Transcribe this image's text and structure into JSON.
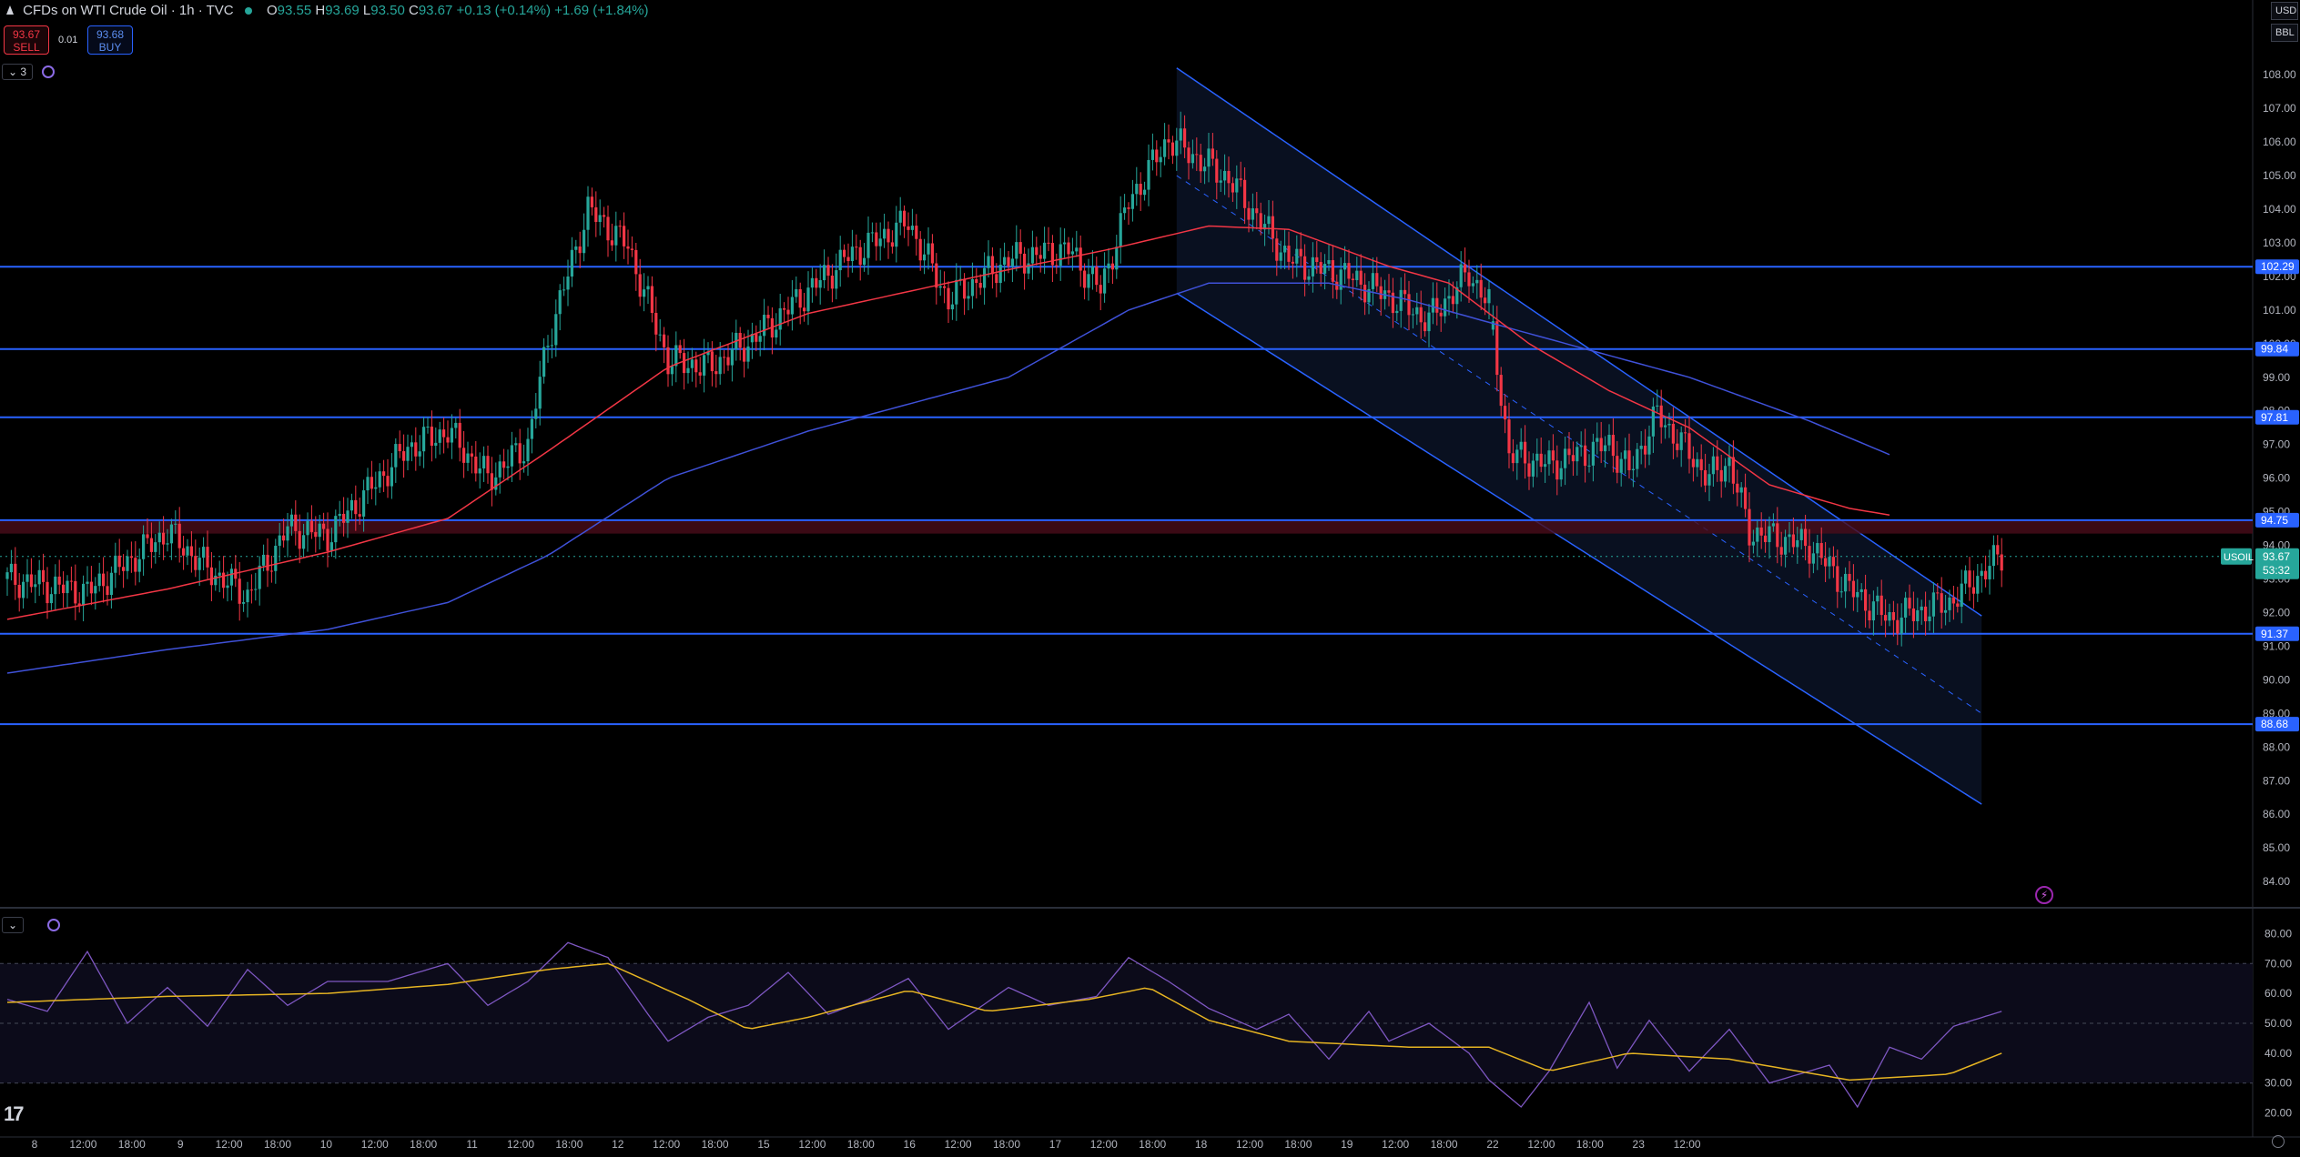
{
  "symbol": {
    "title": "CFDs on WTI Crude Oil · 1h · TVC",
    "open_label": "O",
    "open": "93.55",
    "high_label": "H",
    "high": "93.69",
    "low_label": "L",
    "low": "93.50",
    "close_label": "C",
    "close": "93.67",
    "change": "+0.13 (+0.14%)",
    "change_day": "+1.69 (+1.84%)"
  },
  "trade": {
    "sell_price": "93.67",
    "sell_label": "SELL",
    "buy_price": "93.68",
    "buy_label": "BUY",
    "spread": "0.01"
  },
  "indicators_toggle": "3",
  "currency": "USD",
  "unit": "BBL",
  "price_axis": {
    "ticks": [
      "108.00",
      "107.00",
      "106.00",
      "105.00",
      "104.00",
      "103.00",
      "102.00",
      "101.00",
      "100.00",
      "99.00",
      "98.00",
      "97.00",
      "96.00",
      "95.00",
      "94.00",
      "93.00",
      "92.00",
      "91.00",
      "90.00",
      "89.00",
      "88.00",
      "87.00",
      "86.00",
      "85.00",
      "84.00"
    ],
    "levels": [
      {
        "value": 102.29,
        "label": "102.29"
      },
      {
        "value": 99.84,
        "label": "99.84"
      },
      {
        "value": 97.81,
        "label": "97.81"
      },
      {
        "value": 94.75,
        "label": "94.75"
      },
      {
        "value": 91.37,
        "label": "91.37"
      },
      {
        "value": 88.68,
        "label": "88.68"
      }
    ],
    "current": {
      "symbol": "USOIL",
      "price": "93.67",
      "countdown": "53:32",
      "value": 93.67
    }
  },
  "rsi_axis": {
    "ticks": [
      "80.00",
      "70.00",
      "60.00",
      "50.00",
      "40.00",
      "30.00",
      "20.00"
    ]
  },
  "time_axis": [
    "8",
    "12:00",
    "18:00",
    "9",
    "12:00",
    "18:00",
    "10",
    "12:00",
    "18:00",
    "11",
    "12:00",
    "18:00",
    "12",
    "12:00",
    "18:00",
    "15",
    "12:00",
    "18:00",
    "16",
    "12:00",
    "18:00",
    "17",
    "12:00",
    "18:00",
    "18",
    "12:00",
    "18:00",
    "19",
    "12:00",
    "18:00",
    "22",
    "12:00",
    "18:00",
    "23",
    "12:00"
  ],
  "colors": {
    "up": "#26a69a",
    "down": "#f23645",
    "level": "#2962ff",
    "ma_fast": "#f23645",
    "ma_slow": "#3f51d8",
    "rsi": "#7e57c2",
    "rsi_ma": "#e6b422"
  },
  "icons": {
    "indicator": "indicator-settings-icon",
    "collapse": "chevron-down-icon",
    "logo": "tradingview-logo-icon",
    "alert": "lightning-icon",
    "settings": "gear-icon"
  },
  "logo_text": "17",
  "alert_glyph": "⚡",
  "collapse_glyph": "⌄",
  "chart_data": {
    "type": "candlestick",
    "price_ylim": [
      83.3,
      108.6
    ],
    "rsi_ylim": [
      15,
      85
    ],
    "close_anchors": [
      [
        0,
        93.0
      ],
      [
        20,
        92.6
      ],
      [
        40,
        94.4
      ],
      [
        50,
        93.3
      ],
      [
        60,
        92.5
      ],
      [
        70,
        94.5
      ],
      [
        80,
        94.3
      ],
      [
        100,
        96.9
      ],
      [
        110,
        97.4
      ],
      [
        120,
        96.0
      ],
      [
        130,
        97.0
      ],
      [
        135,
        100.1
      ],
      [
        145,
        104.0
      ],
      [
        155,
        102.9
      ],
      [
        165,
        99.5
      ],
      [
        175,
        99.3
      ],
      [
        185,
        100.0
      ],
      [
        210,
        102.6
      ],
      [
        225,
        103.6
      ],
      [
        235,
        101.3
      ],
      [
        250,
        102.5
      ],
      [
        265,
        102.8
      ],
      [
        273,
        101.6
      ],
      [
        280,
        104.2
      ],
      [
        290,
        106.1
      ],
      [
        305,
        104.9
      ],
      [
        320,
        102.5
      ],
      [
        335,
        102.0
      ],
      [
        345,
        101.4
      ],
      [
        355,
        100.7
      ],
      [
        365,
        102.1
      ],
      [
        370,
        101.2
      ],
      [
        375,
        96.7
      ],
      [
        385,
        96.4
      ],
      [
        400,
        97.0
      ],
      [
        405,
        96.2
      ],
      [
        412,
        97.9
      ],
      [
        425,
        96.0
      ],
      [
        430,
        96.5
      ],
      [
        435,
        94.4
      ],
      [
        450,
        94.0
      ],
      [
        460,
        92.7
      ],
      [
        470,
        91.8
      ],
      [
        485,
        92.3
      ],
      [
        498,
        93.7
      ]
    ],
    "gaps_after_index": [
      185,
      370
    ],
    "ma_fast_anchors": [
      [
        0,
        91.8
      ],
      [
        40,
        92.7
      ],
      [
        80,
        93.8
      ],
      [
        110,
        94.8
      ],
      [
        135,
        96.8
      ],
      [
        165,
        99.3
      ],
      [
        200,
        100.9
      ],
      [
        250,
        102.2
      ],
      [
        275,
        102.8
      ],
      [
        300,
        103.5
      ],
      [
        320,
        103.4
      ],
      [
        345,
        102.3
      ],
      [
        360,
        101.8
      ],
      [
        380,
        100.0
      ],
      [
        400,
        98.6
      ],
      [
        420,
        97.5
      ],
      [
        440,
        95.8
      ],
      [
        460,
        95.1
      ],
      [
        470,
        94.9
      ]
    ],
    "ma_slow_anchors": [
      [
        0,
        90.2
      ],
      [
        40,
        90.9
      ],
      [
        80,
        91.5
      ],
      [
        110,
        92.3
      ],
      [
        135,
        93.7
      ],
      [
        165,
        96.0
      ],
      [
        200,
        97.4
      ],
      [
        250,
        99.0
      ],
      [
        280,
        101.0
      ],
      [
        300,
        101.8
      ],
      [
        330,
        101.8
      ],
      [
        350,
        101.3
      ],
      [
        380,
        100.3
      ],
      [
        420,
        99.0
      ],
      [
        450,
        97.7
      ],
      [
        470,
        96.7
      ]
    ],
    "rsi_anchors": [
      [
        0,
        58
      ],
      [
        10,
        54
      ],
      [
        20,
        74
      ],
      [
        30,
        50
      ],
      [
        40,
        62
      ],
      [
        50,
        49
      ],
      [
        60,
        68
      ],
      [
        70,
        56
      ],
      [
        80,
        64
      ],
      [
        95,
        64
      ],
      [
        110,
        70
      ],
      [
        120,
        56
      ],
      [
        130,
        64
      ],
      [
        140,
        77
      ],
      [
        150,
        72
      ],
      [
        160,
        53
      ],
      [
        165,
        44
      ],
      [
        175,
        52
      ],
      [
        185,
        56
      ],
      [
        195,
        67
      ],
      [
        205,
        53
      ],
      [
        215,
        58
      ],
      [
        225,
        65
      ],
      [
        235,
        48
      ],
      [
        250,
        62
      ],
      [
        260,
        56
      ],
      [
        272,
        59
      ],
      [
        280,
        72
      ],
      [
        290,
        64
      ],
      [
        300,
        55
      ],
      [
        312,
        48
      ],
      [
        320,
        53
      ],
      [
        330,
        38
      ],
      [
        340,
        54
      ],
      [
        345,
        44
      ],
      [
        355,
        50
      ],
      [
        365,
        40
      ],
      [
        370,
        31
      ],
      [
        378,
        22
      ],
      [
        385,
        34
      ],
      [
        395,
        57
      ],
      [
        402,
        35
      ],
      [
        410,
        51
      ],
      [
        420,
        34
      ],
      [
        430,
        48
      ],
      [
        440,
        30
      ],
      [
        455,
        36
      ],
      [
        462,
        22
      ],
      [
        470,
        42
      ],
      [
        478,
        38
      ],
      [
        486,
        49
      ],
      [
        498,
        54
      ]
    ],
    "rsi_ma_anchors": [
      [
        0,
        57
      ],
      [
        40,
        59
      ],
      [
        80,
        60
      ],
      [
        110,
        63
      ],
      [
        135,
        68
      ],
      [
        150,
        70
      ],
      [
        170,
        58
      ],
      [
        185,
        48
      ],
      [
        200,
        52
      ],
      [
        225,
        61
      ],
      [
        245,
        54
      ],
      [
        270,
        58
      ],
      [
        285,
        62
      ],
      [
        300,
        51
      ],
      [
        320,
        44
      ],
      [
        350,
        42
      ],
      [
        370,
        42
      ],
      [
        385,
        34
      ],
      [
        405,
        40
      ],
      [
        430,
        38
      ],
      [
        460,
        31
      ],
      [
        485,
        33
      ],
      [
        498,
        40
      ]
    ],
    "channel": {
      "upper": [
        [
          292,
          108.2
        ],
        [
          493,
          91.9
        ]
      ],
      "mid": [
        [
          292,
          105.0
        ],
        [
          493,
          89.0
        ]
      ],
      "lower": [
        [
          292,
          101.5
        ],
        [
          493,
          86.3
        ]
      ]
    }
  }
}
